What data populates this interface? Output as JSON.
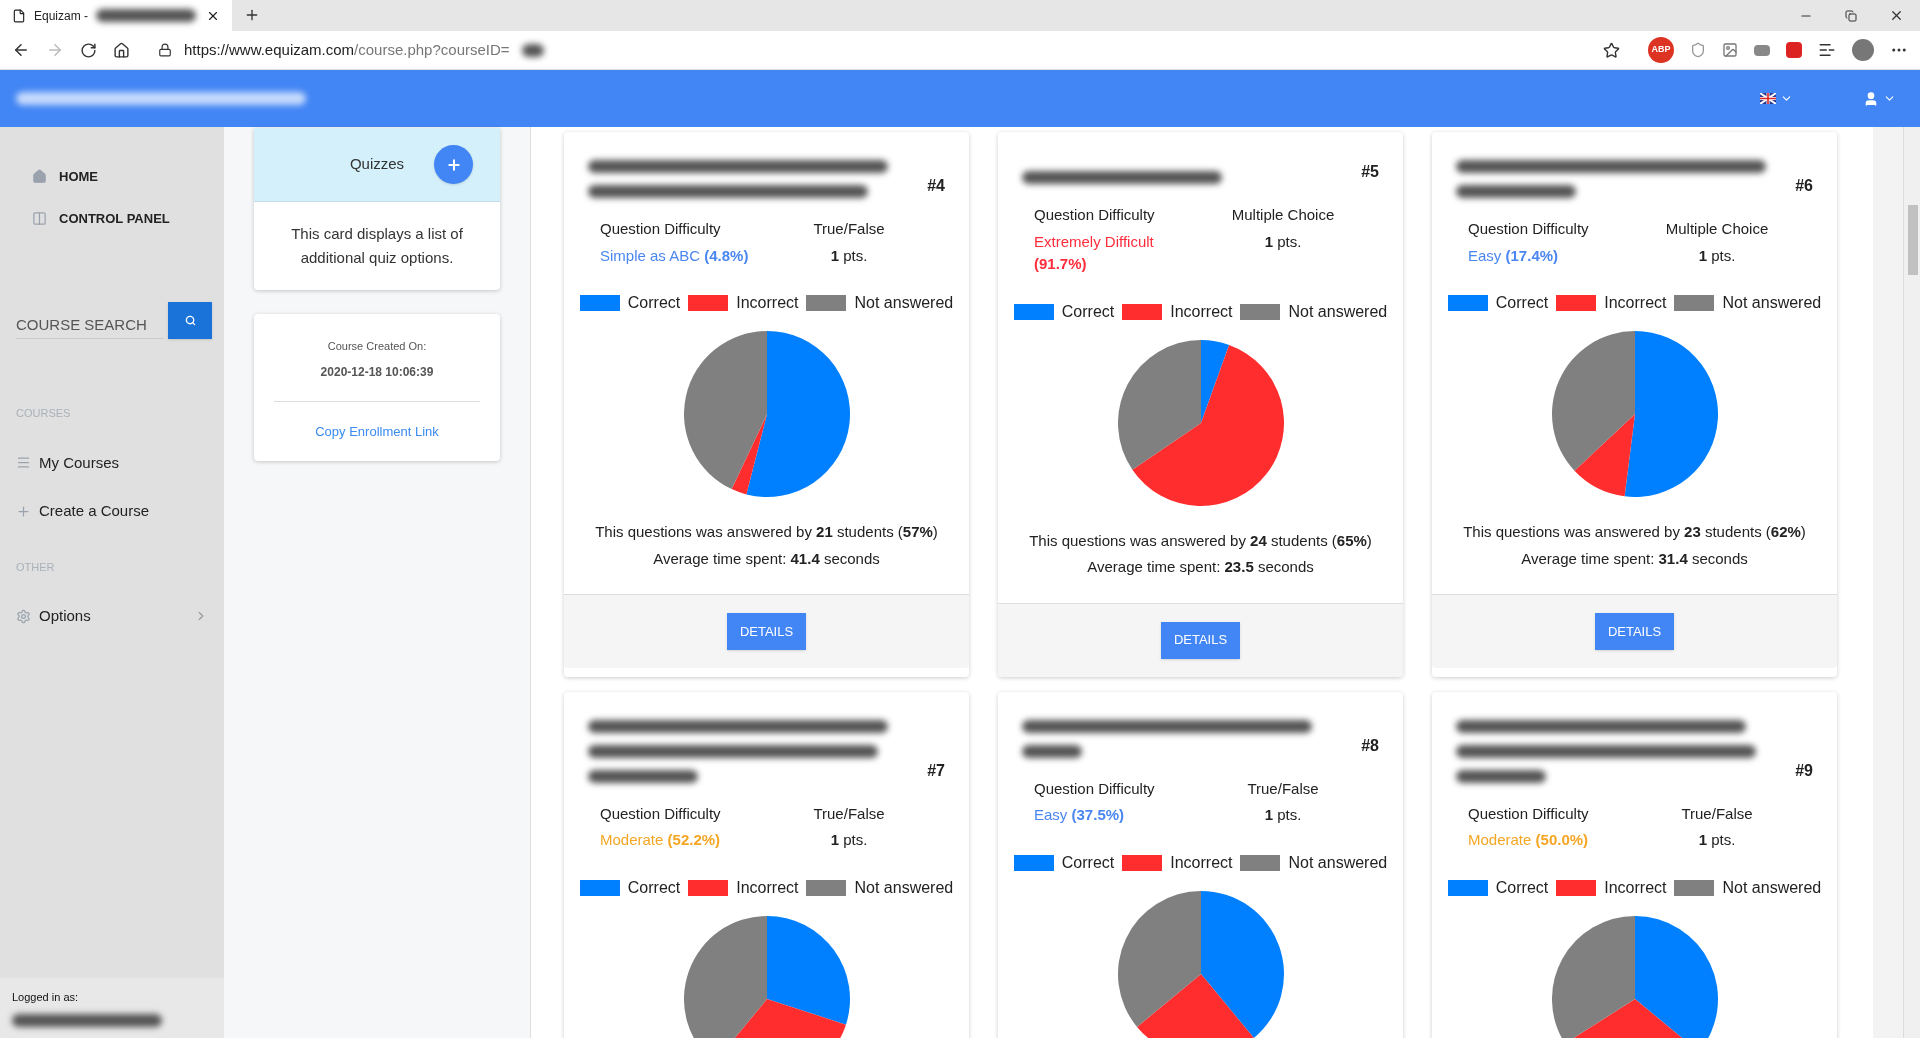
{
  "browser": {
    "tab_title": "Equizam - ",
    "url_host": "https://www.equizam.com",
    "url_path": "/course.php?courseID=",
    "extension_badge": "ABP"
  },
  "sidebar": {
    "nav": [
      {
        "label": "HOME",
        "kind": "home"
      },
      {
        "label": "CONTROL PANEL",
        "kind": "panel"
      }
    ],
    "search": {
      "placeholder": "COURSE SEARCH"
    },
    "sections": [
      {
        "heading": "COURSES",
        "items": [
          {
            "label": "My Courses",
            "kind": "list",
            "has_submenu": false
          },
          {
            "label": "Create a Course",
            "kind": "plus",
            "has_submenu": false
          }
        ]
      },
      {
        "heading": "OTHER",
        "items": [
          {
            "label": "Options",
            "kind": "gear",
            "has_submenu": true
          }
        ]
      }
    ],
    "footer": {
      "label": "Logged in as:"
    }
  },
  "quizzes_card": {
    "title": "Quizzes",
    "description": "This card displays a list of additional quiz options."
  },
  "course_card": {
    "created_label": "Course Created On:",
    "created_value": "2020-12-18 10:06:39",
    "link": "Copy Enrollment Link"
  },
  "questions": [
    {
      "number": "#4",
      "difficulty_label": "Question Difficulty",
      "difficulty": {
        "label": "Simple as ABC",
        "percent": "(4.8%)",
        "color": "#4a86f0"
      },
      "type": "True/False",
      "points": "**1** pts.",
      "legend": [
        {
          "label": "Correct",
          "color": "#0080ff"
        },
        {
          "label": "Incorrect",
          "color": "#ff2d2d"
        },
        {
          "label": "Not answered",
          "color": "#808080"
        }
      ],
      "answered": "This questions was answered by **21** students (**57%**)",
      "time": "Average time spent: **41.4** seconds",
      "button": "DETAILS"
    },
    {
      "number": "#5",
      "difficulty_label": "Question Difficulty",
      "difficulty": {
        "label": "Extremely Difficult",
        "percent": "(91.7%)",
        "color": "#ff2d3c"
      },
      "type": "Multiple Choice",
      "points": "**1** pts.",
      "legend": [
        {
          "label": "Correct",
          "color": "#0080ff"
        },
        {
          "label": "Incorrect",
          "color": "#ff2d2d"
        },
        {
          "label": "Not answered",
          "color": "#808080"
        }
      ],
      "answered": "This questions was answered by **24** students (**65%**)",
      "time": "Average time spent: **23.5** seconds",
      "button": "DETAILS"
    },
    {
      "number": "#6",
      "difficulty_label": "Question Difficulty",
      "difficulty": {
        "label": "Easy",
        "percent": "(17.4%)",
        "color": "#4a86f0"
      },
      "type": "Multiple Choice",
      "points": "**1** pts.",
      "legend": [
        {
          "label": "Correct",
          "color": "#0080ff"
        },
        {
          "label": "Incorrect",
          "color": "#ff2d2d"
        },
        {
          "label": "Not answered",
          "color": "#808080"
        }
      ],
      "answered": "This questions was answered by **23** students (**62%**)",
      "time": "Average time spent: **31.4** seconds",
      "button": "DETAILS"
    },
    {
      "number": "#7",
      "difficulty_label": "Question Difficulty",
      "difficulty": {
        "label": "Moderate",
        "percent": "(52.2%)",
        "color": "#f5a623"
      },
      "type": "True/False",
      "points": "**1** pts.",
      "legend": [
        {
          "label": "Correct",
          "color": "#0080ff"
        },
        {
          "label": "Incorrect",
          "color": "#ff2d2d"
        },
        {
          "label": "Not answered",
          "color": "#808080"
        }
      ]
    },
    {
      "number": "#8",
      "difficulty_label": "Question Difficulty",
      "difficulty": {
        "label": "Easy",
        "percent": "(37.5%)",
        "color": "#4a86f0"
      },
      "type": "True/False",
      "points": "**1** pts.",
      "legend": [
        {
          "label": "Correct",
          "color": "#0080ff"
        },
        {
          "label": "Incorrect",
          "color": "#ff2d2d"
        },
        {
          "label": "Not answered",
          "color": "#808080"
        }
      ]
    },
    {
      "number": "#9",
      "difficulty_label": "Question Difficulty",
      "difficulty": {
        "label": "Moderate",
        "percent": "(50.0%)",
        "color": "#f5a623"
      },
      "type": "True/False",
      "points": "**1** pts.",
      "legend": [
        {
          "label": "Correct",
          "color": "#0080ff"
        },
        {
          "label": "Incorrect",
          "color": "#ff2d2d"
        },
        {
          "label": "Not answered",
          "color": "#808080"
        }
      ]
    }
  ]
}
